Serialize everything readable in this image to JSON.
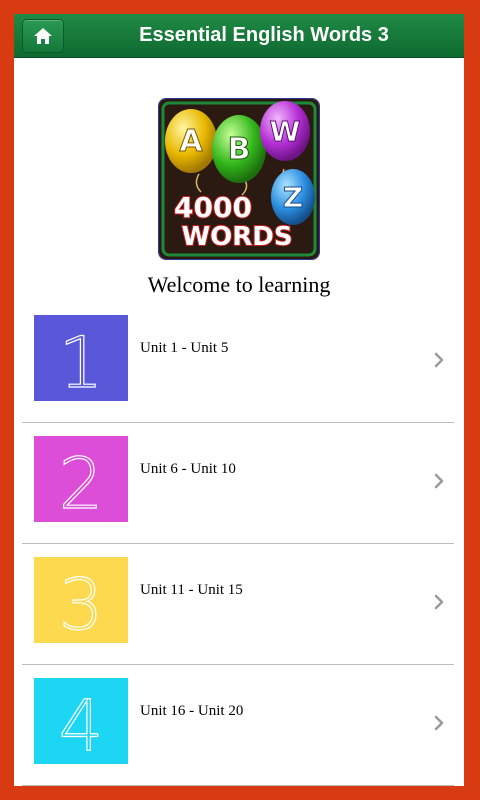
{
  "header": {
    "title": "Essential English Words 3",
    "home_icon": "home-icon"
  },
  "logo": {
    "balloon_letters": [
      "A",
      "B",
      "W",
      "Z"
    ],
    "text_line1": "4000",
    "text_line2": "WORDS"
  },
  "welcome": "Welcome to learning",
  "units": [
    {
      "number": "1",
      "label": "Unit 1 - Unit 5",
      "color": "#5a57d8"
    },
    {
      "number": "2",
      "label": "Unit 6 - Unit 10",
      "color": "#dc4dd8"
    },
    {
      "number": "3",
      "label": "Unit 11 - Unit 15",
      "color": "#fcd94e"
    },
    {
      "number": "4",
      "label": "Unit 16 - Unit 20",
      "color": "#1dd6f3"
    }
  ],
  "colors": {
    "frame": "#d83a12",
    "header": "#137838",
    "chevron": "#9a9a9a"
  }
}
